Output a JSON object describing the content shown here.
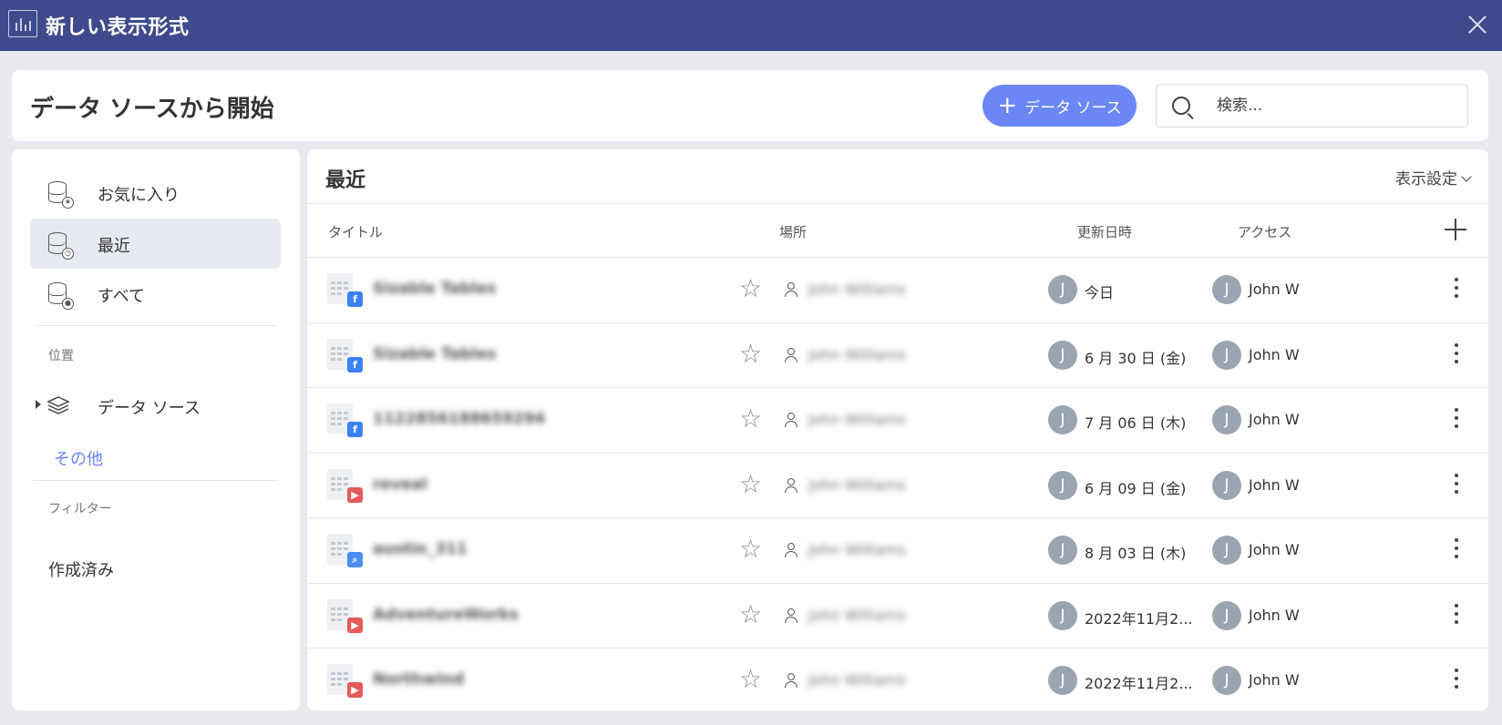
{
  "window": {
    "title": "新しい表示形式",
    "app_icon": "chart-icon",
    "close_icon": "close-icon"
  },
  "header": {
    "heading": "データ ソースから開始",
    "add_button_label": "データ ソース",
    "search_placeholder": "検索..."
  },
  "sidebar": {
    "favorites_label": "お気に入り",
    "recent_label": "最近",
    "all_label": "すべて",
    "location_section": "位置",
    "data_sources_label": "データ ソース",
    "other_link": "その他",
    "filter_section": "フィルター",
    "created_label": "作成済み"
  },
  "main": {
    "title": "最近",
    "view_settings": "表示設定",
    "columns": {
      "title": "タイトル",
      "location": "場所",
      "updated": "更新日時",
      "access": "アクセス"
    },
    "rows": [
      {
        "name": "Sizable Tables",
        "badge": "f",
        "badge_type": "fb",
        "owner": "John Williams",
        "updated_initial": "J",
        "updated": "今日",
        "access_initial": "J",
        "access": "John W"
      },
      {
        "name": "Sizable Tables",
        "badge": "f",
        "badge_type": "fb",
        "owner": "John Williams",
        "updated_initial": "J",
        "updated": "6 月 30 日 (金)",
        "access_initial": "J",
        "access": "John W"
      },
      {
        "name": "1122856188659294",
        "badge": "f",
        "badge_type": "fb",
        "owner": "John Williams",
        "updated_initial": "J",
        "updated": "7 月 06 日 (木)",
        "access_initial": "J",
        "access": "John W"
      },
      {
        "name": "reveal",
        "badge": "▶",
        "badge_type": "red",
        "owner": "John Williams",
        "updated_initial": "J",
        "updated": "6 月 09 日 (金)",
        "access_initial": "J",
        "access": "John W"
      },
      {
        "name": "austin_311",
        "badge": "⌕",
        "badge_type": "blue",
        "owner": "John Williams",
        "updated_initial": "J",
        "updated": "8 月 03 日 (木)",
        "access_initial": "J",
        "access": "John W"
      },
      {
        "name": "AdventureWorks",
        "badge": "▶",
        "badge_type": "red",
        "owner": "John Williams",
        "updated_initial": "J",
        "updated": "2022年11月2...",
        "access_initial": "J",
        "access": "John W"
      },
      {
        "name": "Northwind",
        "badge": "▶",
        "badge_type": "red",
        "owner": "John Williams",
        "updated_initial": "J",
        "updated": "2022年11月2...",
        "access_initial": "J",
        "access": "John W"
      }
    ]
  },
  "colors": {
    "titlebar": "#3f4a8c",
    "accent": "#6b87f5",
    "avatar": "#9aa5b1"
  }
}
